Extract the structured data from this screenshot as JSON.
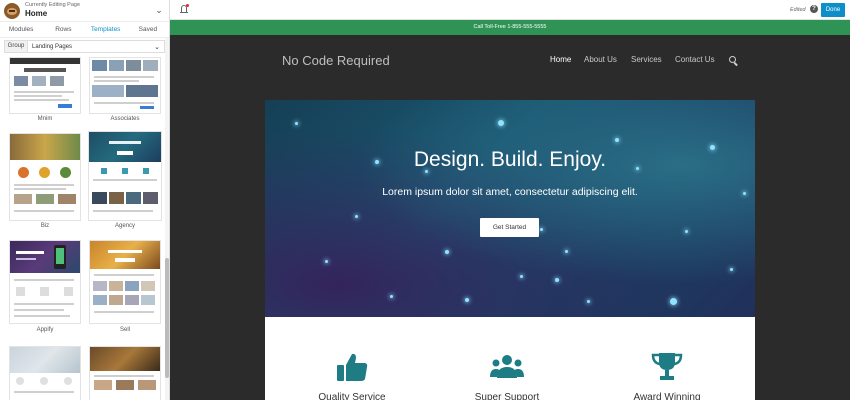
{
  "panel": {
    "subtitle": "Currently Editing Page",
    "page_name": "Home",
    "tabs": [
      "Modules",
      "Rows",
      "Templates",
      "Saved"
    ],
    "active_tab": "Templates",
    "group_label": "Group",
    "group_value": "Landing Pages",
    "templates": [
      "Mnim",
      "Associates",
      "Biz",
      "Agency",
      "Appify",
      "Sell"
    ]
  },
  "topbar": {
    "status": "Edited",
    "help": "?",
    "done_label": "Done"
  },
  "site": {
    "banner": "Call Toll-Free 1-855-555-5555",
    "brand": "No Code Required",
    "nav": [
      "Home",
      "About Us",
      "Services",
      "Contact Us"
    ],
    "active_nav": "Home",
    "hero_title": "Design. Build. Enjoy.",
    "hero_subtitle": "Lorem ipsum dolor sit amet, consectetur adipiscing elit.",
    "cta": "Get Started",
    "features": [
      "Quality Service",
      "Super Support",
      "Award Winning"
    ],
    "colors": {
      "accent": "#0e8fc8",
      "banner": "#2f9355",
      "feature_icon": "#1d7c84"
    }
  }
}
